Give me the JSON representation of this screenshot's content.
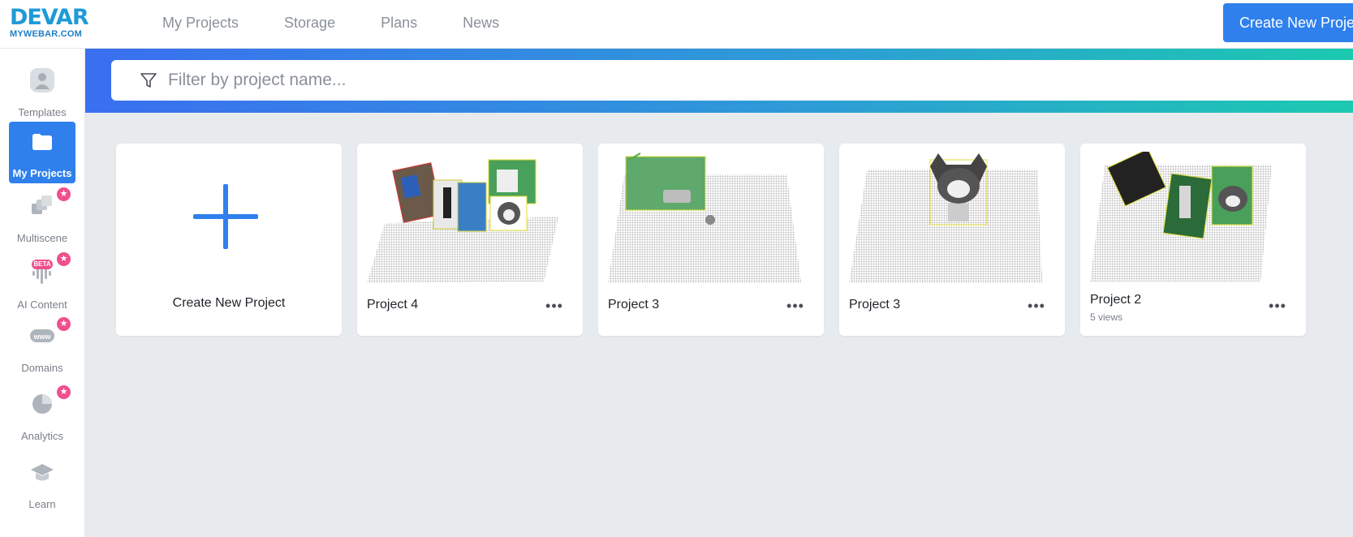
{
  "brand": {
    "logo_main": "DEVAR",
    "logo_sub": "MYWEBAR.COM"
  },
  "topnav": {
    "items": [
      {
        "label": "My Projects"
      },
      {
        "label": "Storage"
      },
      {
        "label": "Plans"
      },
      {
        "label": "News"
      }
    ],
    "create_button_label": "Create New Project"
  },
  "sidebar": {
    "items": [
      {
        "label": "Templates",
        "icon": "user-avatar-icon",
        "active": false,
        "star": false
      },
      {
        "label": "My Projects",
        "icon": "folder-icon",
        "active": true,
        "star": false
      },
      {
        "label": "Multiscene",
        "icon": "layers-icon",
        "active": false,
        "star": true
      },
      {
        "label": "AI Content",
        "icon": "audio-wave-icon",
        "active": false,
        "star": true,
        "badge": "BETA"
      },
      {
        "label": "Domains",
        "icon": "www-icon",
        "active": false,
        "star": true,
        "badge": "www"
      },
      {
        "label": "Analytics",
        "icon": "pie-chart-icon",
        "active": false,
        "star": true
      },
      {
        "label": "Learn",
        "icon": "graduation-cap-icon",
        "active": false,
        "star": false
      }
    ],
    "star_glyph": "★"
  },
  "filter": {
    "placeholder": "Filter by project name..."
  },
  "new_project_card": {
    "label": "Create New Project"
  },
  "projects": [
    {
      "name": "Project 4",
      "views": ""
    },
    {
      "name": "Project 3",
      "views": ""
    },
    {
      "name": "Project 3",
      "views": ""
    },
    {
      "name": "Project 2",
      "views": "5 views"
    }
  ],
  "more_glyph": "•••",
  "colors": {
    "accent": "#2f80ed",
    "star": "#ef4f8e",
    "banner_start": "#3a6ff0",
    "banner_end": "#1cc9b0",
    "page_bg": "#e8ebee"
  }
}
